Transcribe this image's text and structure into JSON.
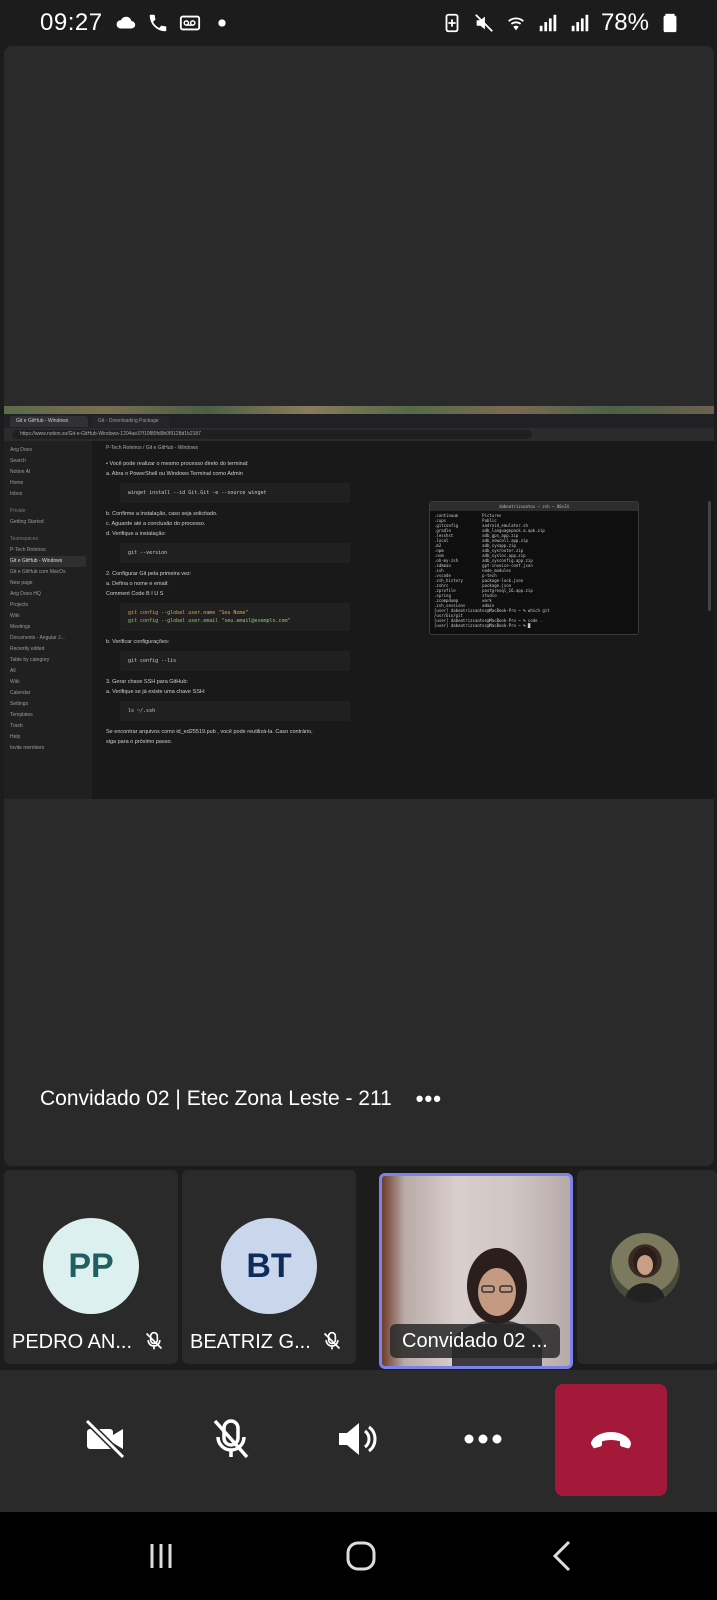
{
  "status_bar": {
    "time": "09:27",
    "battery": "78%",
    "left_icons": [
      "cloud-icon",
      "phone-icon",
      "voicemail-icon",
      "dot-icon"
    ],
    "right_icons": [
      "battery-saver-icon",
      "mute-icon",
      "wifi-icon",
      "signal-icon",
      "signal-icon",
      "battery-icon"
    ]
  },
  "stage": {
    "presenter_name": "Convidado 02 | Etec Zona Leste - 211",
    "more_label": "•••"
  },
  "shared_screen": {
    "tabs": [
      "Git e GitHub - Windows",
      "Git - Downloading Package"
    ],
    "url": "https://www.notion.so/Git-e-GitHub-Windows-1204ae37f10f80fd9b0f9128d1b2187",
    "breadcrumb": "P-Tech Roteiros / Git e GitHub - Windows",
    "sidebar": {
      "workspace": "Ang Does",
      "top_items": [
        "Search",
        "Notion AI",
        "Home",
        "Inbox"
      ],
      "private_label": "Private",
      "private_items": [
        "Getting Started"
      ],
      "teamspaces_label": "Teamspaces",
      "team_items": [
        "P-Tech Roteiros",
        "Git e GitHub - Windows",
        "Git e GitHub com MacOs",
        "New page"
      ],
      "hq_items": [
        "Ang Does HQ",
        "Projects",
        "Wiki",
        "Meetings",
        "Documents - Angular J...",
        "Recently edited",
        "Table by category",
        "All",
        "Wiki"
      ],
      "bottom_items": [
        "Calendar",
        "Settings",
        "Templates",
        "Trash",
        "Help",
        "Invite members"
      ]
    },
    "content": {
      "lines": [
        "• Você pode realizar o mesmo processo direto do terminal:",
        "a. Abra o PowerShell ou Windows Terminal como Admin",
        "b. Confirme a instalação, caso seja solicitado.",
        "c. Aguarde até a conclusão do processo.",
        "d. Verifique a instalação:",
        "2. Configurar Git pela primeira vez:",
        "a. Defina o nome e email:",
        "b. Verificar configurações:",
        "3. Gerar chave SSH para GitHub:",
        "a. Verifique se já existe uma chave SSH:",
        "Se encontrar arquivos como id_ed25519.pub , você pode reutilizá-la. Caso contrário,",
        "siga para o próximo passo."
      ],
      "code_winget": "winget install --id Git.Git -e --source winget",
      "code_version": "git --version",
      "code_config_1": "git config --global user.name \"Seu Nome\"",
      "code_config_2": "git config --global user.email \"seu.email@exemplo.com\"",
      "code_list": "git config --lis",
      "code_ls": "ls ~/.ssh",
      "format_toolbar": "Comment   Code   B  I  U  S"
    },
    "terminal": {
      "title": "dabeatrizsantos — zsh — 80×24",
      "body": ".continuum          Pictures\n.cups               Public\n.gitconfig          android_emulator.sh\n.gradle             adb_languagepack.a.apk.zip\n.lesshst            adb_gps_app.zip\n.local              adb_newcall.app.zip\n.m2                 adb_sysapp.zip\n.npm                adb_sysrouter.zip\n.nvm                adb_sysloc.app.zip\n.oh-my-zsh          adb_sysconfig.app.zip\n.sdkman             gpt-invoice-conf.json\n.ssh                node_modules\n.vscode             p-tech\n.zsh_history        package-lock.json\n.zshrc              package.json\n.zprofile           postgresql_16.app.zip\n.spring             studio\n.zcompdump          work\n.zsh_sessions       admin\n[user] dabeatrizsantos@MacBook-Pro ~ % which git\n/usr/bin/git\n[user] dabeatrizsantos@MacBook-Pro ~ % code .\n[user] dabeatrizsantos@MacBook-Pro ~ % █"
    }
  },
  "participants": [
    {
      "initials": "PP",
      "name": "PEDRO AN...",
      "muted": true,
      "avatar_bg": "#ddf0f0",
      "avatar_fg": "#1f5f64"
    },
    {
      "initials": "BT",
      "name": "BEATRIZ G...",
      "muted": true,
      "avatar_bg": "#c9d6ec",
      "avatar_fg": "#0f2b5c"
    },
    {
      "name": "Convidado 02 ...",
      "video": true
    }
  ],
  "controls": [
    "camera-off-icon",
    "mic-off-icon",
    "speaker-icon",
    "more-icon",
    "hang-up-icon"
  ],
  "colors": {
    "accent": "#7b83eb",
    "hangup": "#a4183a",
    "panel": "#2a2a2a"
  }
}
